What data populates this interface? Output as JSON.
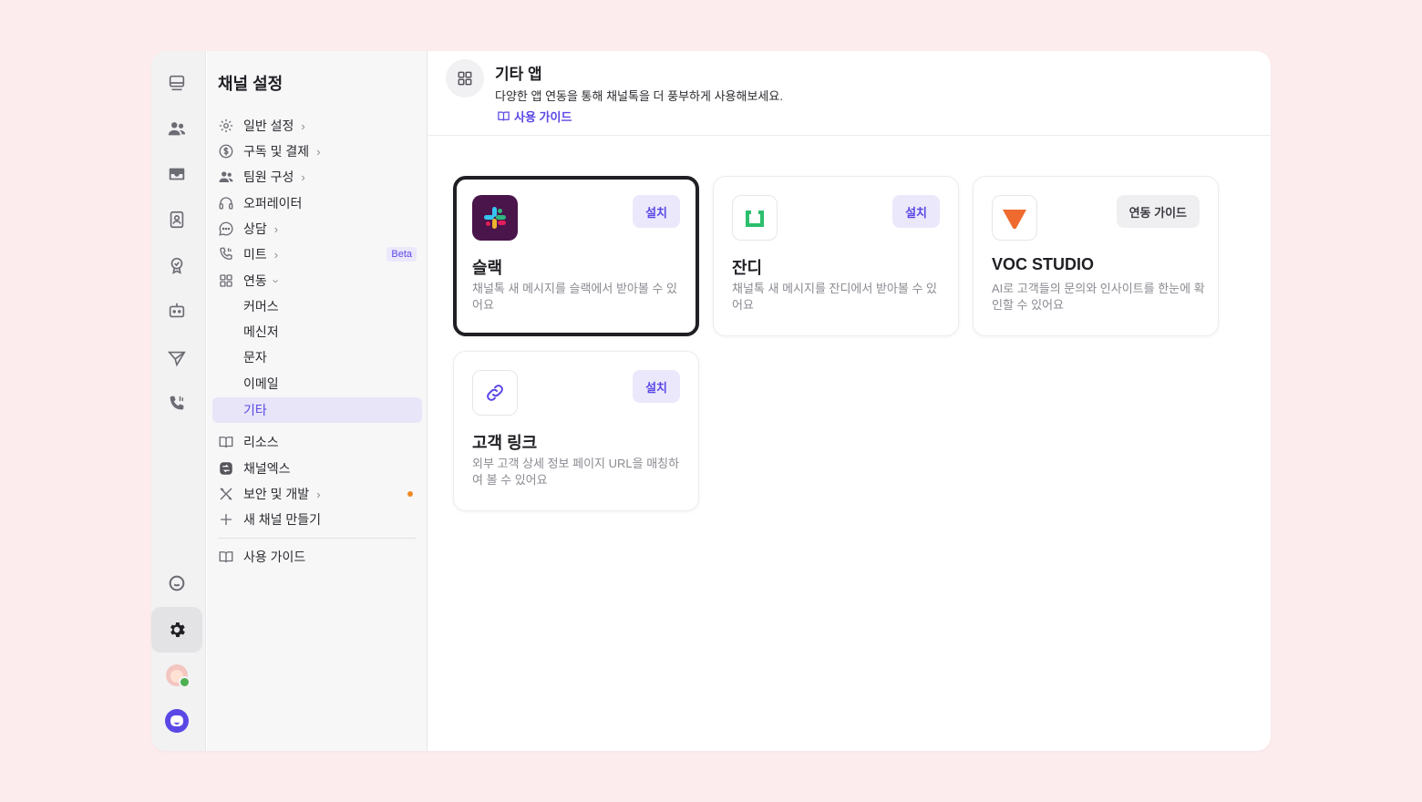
{
  "sidebar": {
    "title": "채널 설정",
    "items": [
      {
        "label": "일반 설정"
      },
      {
        "label": "구독 및 결제"
      },
      {
        "label": "팀원 구성"
      },
      {
        "label": "오퍼레이터"
      },
      {
        "label": "상담"
      },
      {
        "label": "미트",
        "badge": "Beta"
      },
      {
        "label": "연동"
      },
      {
        "label": "커머스"
      },
      {
        "label": "메신저"
      },
      {
        "label": "문자"
      },
      {
        "label": "이메일"
      },
      {
        "label": "기타"
      },
      {
        "label": "리소스"
      },
      {
        "label": "채널엑스"
      },
      {
        "label": "보안 및 개발"
      },
      {
        "label": "새 채널 만들기"
      },
      {
        "label": "사용 가이드"
      }
    ]
  },
  "header": {
    "title": "기타 앱",
    "description": "다양한 앱 연동을 통해 채널톡을 더 풍부하게 사용해보세요.",
    "guide_link": "사용 가이드"
  },
  "apps": [
    {
      "name": "슬랙",
      "description": "채널톡 새 메시지를 슬랙에서 받아볼 수 있어요",
      "button": "설치",
      "icon": "slack-logo"
    },
    {
      "name": "잔디",
      "description": "채널톡 새 메시지를 잔디에서 받아볼 수 있어요",
      "button": "설치",
      "icon": "jandi-logo"
    },
    {
      "name": "VOC STUDIO",
      "description": "AI로 고객들의 문의와 인사이트를 한눈에 확인할 수 있어요",
      "button": "연동 가이드",
      "icon": "voc-studio-logo"
    },
    {
      "name": "고객 링크",
      "description": "외부 고객 상세 정보 페이지 URL을 매칭하여 볼 수 있어요",
      "button": "설치",
      "icon": "link-icon"
    }
  ],
  "colors": {
    "accent": "#5a48e6",
    "background": "#fdecee",
    "notification_dot": "#f08a24"
  }
}
